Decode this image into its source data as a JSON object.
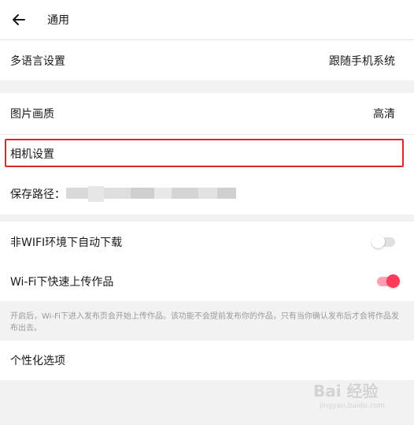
{
  "header": {
    "title": "通用",
    "back_icon": "arrow-left-icon"
  },
  "language": {
    "label": "多语言设置",
    "value": "跟随手机系统"
  },
  "image_quality": {
    "label": "图片画质",
    "value": "高清"
  },
  "camera": {
    "label": "相机设置"
  },
  "save_path": {
    "label": "保存路径："
  },
  "auto_download": {
    "label": "非WIFI环境下自动下载",
    "enabled": false
  },
  "fast_upload": {
    "label": "Wi-Fi下快速上传作品",
    "enabled": true
  },
  "note": {
    "text": "开启后，Wi-Fi下进入发布页会开始上传作品。该功能不会提前发布你的作品，只有当你确认发布后才会将作品发布出去。"
  },
  "personalize": {
    "label": "个性化选项"
  },
  "watermark": {
    "logo": "Bai 经验",
    "sub": "jingyan.baidu.com"
  },
  "colors": {
    "accent": "#ff3b5c",
    "highlight_border": "#e02626",
    "toggle_off": "#e0e0e0"
  }
}
